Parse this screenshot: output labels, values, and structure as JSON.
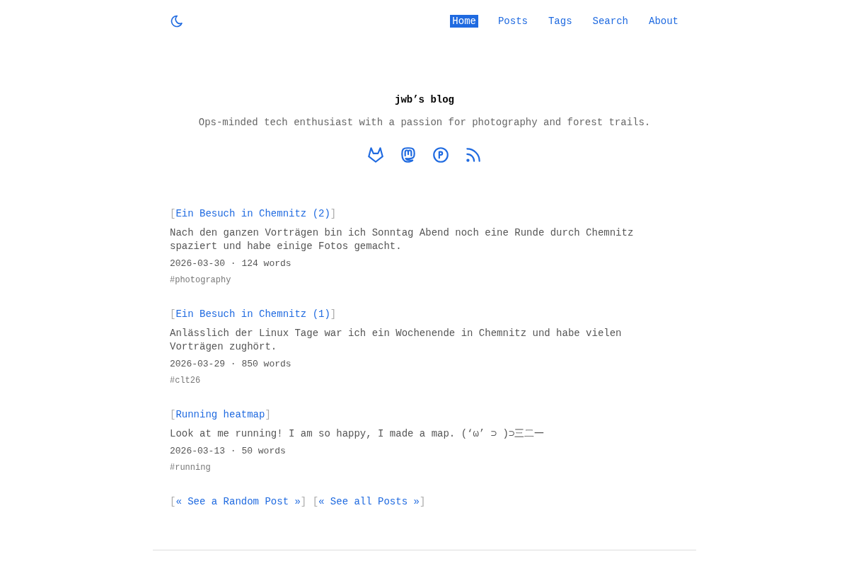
{
  "header": {
    "nav": [
      {
        "label": "Home",
        "selected": true
      },
      {
        "label": "Posts",
        "selected": false
      },
      {
        "label": "Tags",
        "selected": false
      },
      {
        "label": "Search",
        "selected": false
      },
      {
        "label": "About",
        "selected": false
      }
    ]
  },
  "intro": {
    "title": "jwb’s blog",
    "tagline": "Ops-minded tech enthusiast with a passion for photography and forest trails."
  },
  "posts": [
    {
      "open": "[",
      "title": "Ein Besuch in Chemnitz (2)",
      "close": "]",
      "summary": "Nach den ganzen Vorträgen bin ich Sonntag Abend noch eine Runde durch Chemnitz spaziert und habe einige Fotos gemacht.",
      "meta": "2026-03-30 · 124 words",
      "tags": [
        "#photography"
      ]
    },
    {
      "open": "[",
      "title": "Ein Besuch in Chemnitz (1)",
      "close": "]",
      "summary": "Anlässlich der Linux Tage war ich ein Wochenende in Chemnitz und habe vielen Vorträgen zughört.",
      "meta": "2026-03-29 · 850 words",
      "tags": [
        "#clt26"
      ]
    },
    {
      "open": "[",
      "title": "Running heatmap",
      "close": "]",
      "summary": "Look at me running! I am so happy, I made a map. (‘ω’ ⊃ )⊃三二一",
      "meta": "2026-03-13 · 50 words",
      "tags": [
        "#running"
      ]
    }
  ],
  "more_links": [
    {
      "open": "[",
      "label": "« See a Random Post »",
      "close": "]"
    },
    {
      "open": "[",
      "label": "« See all Posts »",
      "close": "]"
    }
  ]
}
